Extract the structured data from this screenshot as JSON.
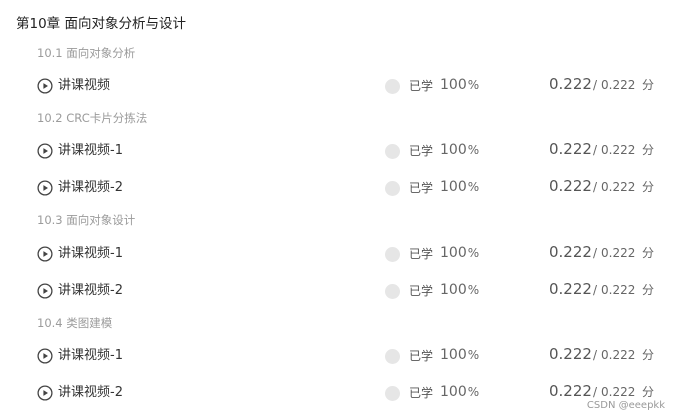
{
  "chapter": {
    "title": "第10章 面向对象分析与设计"
  },
  "sections": [
    {
      "title": "10.1 面向对象分析",
      "lessons": [
        {
          "name": "讲课视频",
          "learned_label": "已学",
          "progress": "100",
          "progress_unit": "%",
          "score": "0.222",
          "score_sep": "/",
          "score_total": "0.222",
          "score_unit": "分"
        }
      ]
    },
    {
      "title": "10.2 CRC卡片分拣法",
      "lessons": [
        {
          "name": "讲课视频-1",
          "learned_label": "已学",
          "progress": "100",
          "progress_unit": "%",
          "score": "0.222",
          "score_sep": "/",
          "score_total": "0.222",
          "score_unit": "分"
        },
        {
          "name": "讲课视频-2",
          "learned_label": "已学",
          "progress": "100",
          "progress_unit": "%",
          "score": "0.222",
          "score_sep": "/",
          "score_total": "0.222",
          "score_unit": "分"
        }
      ]
    },
    {
      "title": "10.3 面向对象设计",
      "lessons": [
        {
          "name": "讲课视频-1",
          "learned_label": "已学",
          "progress": "100",
          "progress_unit": "%",
          "score": "0.222",
          "score_sep": "/",
          "score_total": "0.222",
          "score_unit": "分"
        },
        {
          "name": "讲课视频-2",
          "learned_label": "已学",
          "progress": "100",
          "progress_unit": "%",
          "score": "0.222",
          "score_sep": "/",
          "score_total": "0.222",
          "score_unit": "分"
        }
      ]
    },
    {
      "title": "10.4 类图建模",
      "lessons": [
        {
          "name": "讲课视频-1",
          "learned_label": "已学",
          "progress": "100",
          "progress_unit": "%",
          "score": "0.222",
          "score_sep": "/",
          "score_total": "0.222",
          "score_unit": "分"
        },
        {
          "name": "讲课视频-2",
          "learned_label": "已学",
          "progress": "100",
          "progress_unit": "%",
          "score": "0.222",
          "score_sep": "/",
          "score_total": "0.222",
          "score_unit": "分"
        }
      ]
    }
  ],
  "watermark": "CSDN @eeepkk",
  "colors": {
    "status_dot": "#e6e6e6",
    "play_icon": "#444444",
    "section_text": "#9b9b9b"
  },
  "icons": {
    "lesson": "play-circle-icon",
    "status": "status-dot"
  }
}
